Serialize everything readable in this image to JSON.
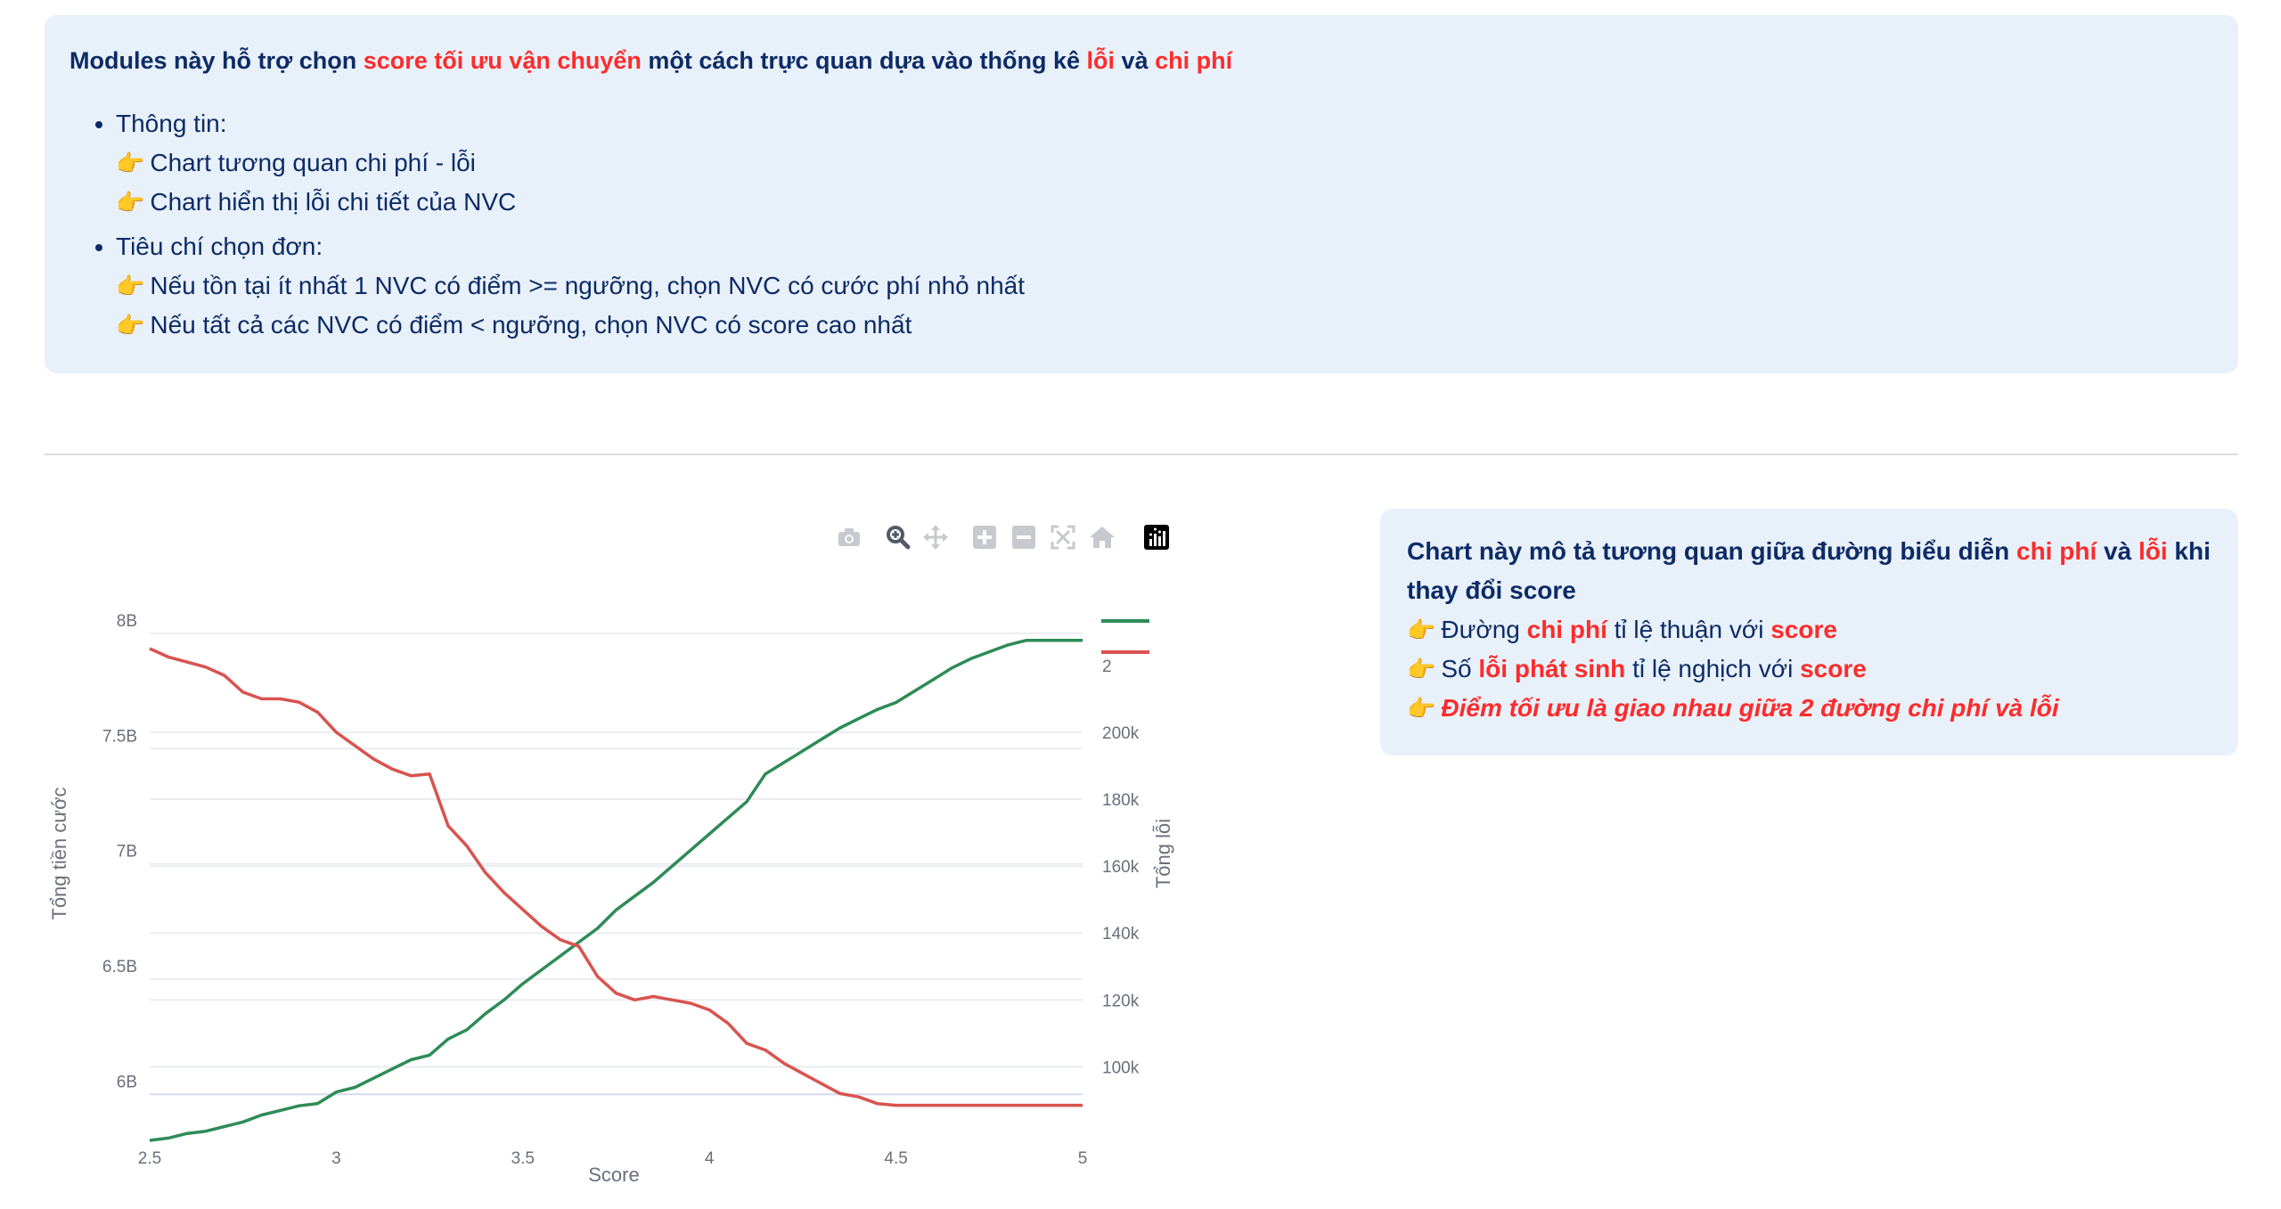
{
  "header": {
    "intro_parts": [
      "Modules này hỗ trợ chọn ",
      "score tối ưu vận chuyển",
      " một cách trực quan dựa vào thống kê ",
      "lỗi",
      " và ",
      "chi phí"
    ],
    "list": [
      {
        "title": "Thông tin:",
        "items": [
          "Chart tương quan chi phí - lỗi",
          "Chart hiển thị lỗi chi tiết của NVC"
        ]
      },
      {
        "title": "Tiêu chí chọn đơn:",
        "items": [
          "Nếu tồn tại ít nhất 1 NVC có điểm >= ngưỡng, chọn NVC có cước phí nhỏ nhất",
          "Nếu tất cả các NVC có điểm < ngưỡng, chọn NVC có score cao nhất"
        ]
      }
    ],
    "hand_glyph": "👉"
  },
  "toolbar": {
    "icons": [
      "camera-icon",
      "zoom-icon",
      "pan-icon",
      "zoom-in-icon",
      "zoom-out-icon",
      "autoscale-icon",
      "reset-axes-icon",
      "plotly-logo-icon"
    ]
  },
  "chart_data": {
    "type": "line",
    "xlabel": "Score",
    "ylabel": "Tổng tiền cước",
    "y2label": "Tổng lỗi",
    "xlim": [
      2.5,
      5
    ],
    "ylim": [
      5.8,
      8.05
    ],
    "y2lim": [
      78000,
      233000
    ],
    "x_ticks": [
      "2.5",
      "3",
      "3.5",
      "4",
      "4.5",
      "5"
    ],
    "y_ticks": [
      "6B",
      "6.5B",
      "7B",
      "7.5B",
      "8B"
    ],
    "y2_ticks": [
      "100k",
      "120k",
      "140k",
      "160k",
      "180k",
      "200k",
      "2"
    ],
    "grid": true,
    "legend_position": "top-right",
    "colors": {
      "cost": "#2e8b57",
      "errors": "#d9534f"
    },
    "series": [
      {
        "name": "",
        "axis": "y",
        "color": "#2e8b57",
        "x": [
          2.5,
          2.55,
          2.6,
          2.65,
          2.7,
          2.75,
          2.8,
          2.85,
          2.9,
          2.95,
          3.0,
          3.05,
          3.1,
          3.15,
          3.2,
          3.25,
          3.3,
          3.35,
          3.4,
          3.45,
          3.5,
          3.55,
          3.6,
          3.65,
          3.7,
          3.75,
          3.8,
          3.85,
          3.9,
          3.95,
          4.0,
          4.05,
          4.1,
          4.15,
          4.2,
          4.25,
          4.3,
          4.35,
          4.4,
          4.45,
          4.5,
          4.55,
          4.6,
          4.65,
          4.7,
          4.75,
          4.8,
          4.85,
          4.9,
          4.95,
          5.0
        ],
        "y": [
          5.8,
          5.81,
          5.83,
          5.84,
          5.86,
          5.88,
          5.91,
          5.93,
          5.95,
          5.96,
          6.01,
          6.03,
          6.07,
          6.11,
          6.15,
          6.17,
          6.24,
          6.28,
          6.35,
          6.41,
          6.48,
          6.54,
          6.6,
          6.66,
          6.72,
          6.8,
          6.86,
          6.92,
          6.99,
          7.06,
          7.13,
          7.2,
          7.27,
          7.39,
          7.44,
          7.49,
          7.54,
          7.59,
          7.63,
          7.67,
          7.7,
          7.75,
          7.8,
          7.85,
          7.89,
          7.92,
          7.95,
          7.97,
          7.97,
          7.97,
          7.97
        ]
      },
      {
        "name": "",
        "axis": "y2",
        "color": "#d9534f",
        "x": [
          2.5,
          2.55,
          2.6,
          2.65,
          2.7,
          2.75,
          2.8,
          2.85,
          2.9,
          2.95,
          3.0,
          3.05,
          3.1,
          3.15,
          3.2,
          3.25,
          3.3,
          3.35,
          3.4,
          3.45,
          3.5,
          3.55,
          3.6,
          3.65,
          3.7,
          3.75,
          3.8,
          3.85,
          3.9,
          3.95,
          4.0,
          4.05,
          4.1,
          4.15,
          4.2,
          4.25,
          4.3,
          4.35,
          4.4,
          4.45,
          4.5,
          4.55,
          4.6,
          4.65,
          4.7,
          4.75,
          4.8,
          4.85,
          4.9,
          4.95,
          5.0
        ],
        "y": [
          225000,
          222500,
          221000,
          219500,
          217000,
          212000,
          210000,
          210000,
          209000,
          206000,
          200000,
          196000,
          192000,
          189000,
          187000,
          187500,
          172000,
          166000,
          158000,
          152000,
          147000,
          142000,
          138000,
          136000,
          127000,
          122000,
          120000,
          121000,
          120000,
          119000,
          117000,
          113000,
          107000,
          105000,
          101000,
          98000,
          95000,
          92000,
          91000,
          89000,
          88500,
          88500,
          88500,
          88500,
          88500,
          88500,
          88500,
          88500,
          88500,
          88500,
          88500
        ]
      }
    ]
  },
  "side_note": {
    "line1_parts": [
      "Chart này mô tả tương quan giữa đường biểu diễn ",
      "chi phí",
      " và ",
      "lỗi",
      " khi thay đổi score"
    ],
    "line2_parts": [
      "Đường ",
      "chi phí",
      " tỉ lệ thuận với ",
      "score"
    ],
    "line3_parts": [
      "Số ",
      "lỗi phát sinh",
      " tỉ lệ nghịch với ",
      "score"
    ],
    "line4": "Điểm tối ưu là giao nhau giữa 2 đường chi phí và lỗi"
  }
}
